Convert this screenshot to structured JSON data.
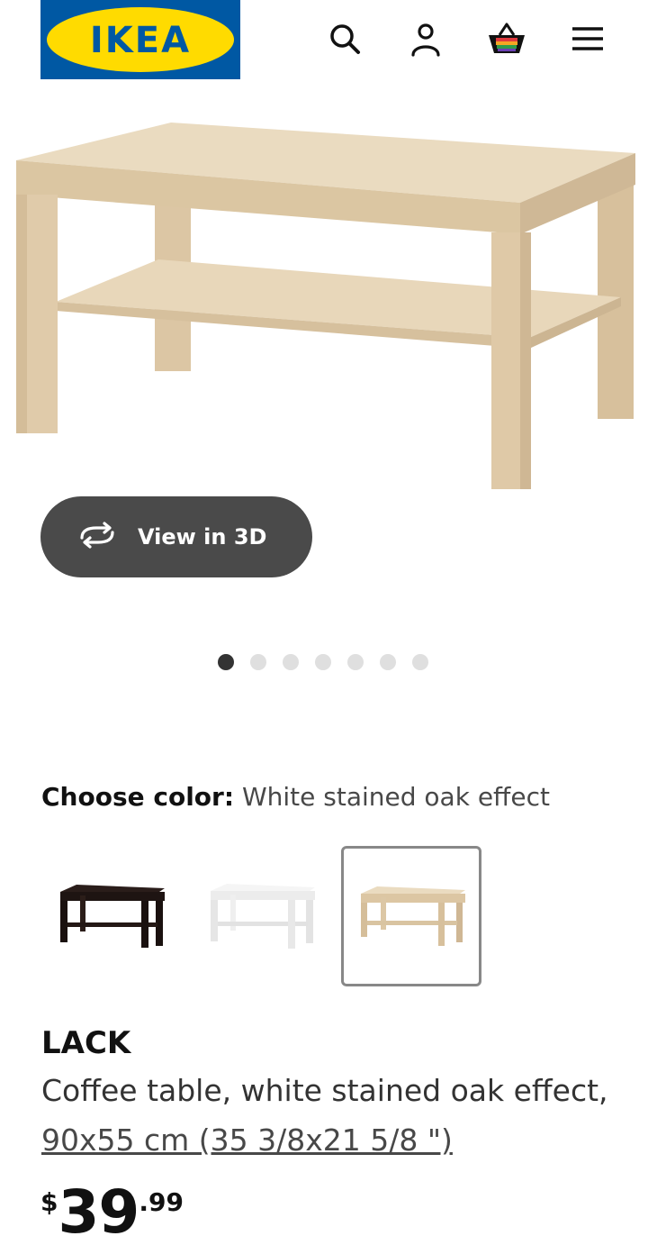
{
  "header": {
    "logo_text": "IKEA",
    "icons": [
      "search-icon",
      "account-icon",
      "cart-icon",
      "menu-icon"
    ]
  },
  "hero": {
    "view3d_label": "View in 3D",
    "carousel_total": 7,
    "carousel_active": 1
  },
  "color_picker": {
    "label": "Choose color:",
    "selected_value": "White stained oak effect",
    "swatches": [
      "black-brown",
      "white",
      "white stained oak effect"
    ],
    "selected_index": 2
  },
  "product": {
    "name": "LACK",
    "description": "Coffee table, white stained oak effect,",
    "size": "90x55 cm (35 3/8x21 5/8 \")",
    "price": {
      "currency": "$",
      "integer": "39",
      "decimal": ".99"
    }
  },
  "colors": {
    "brand_blue": "#0058a3",
    "brand_yellow": "#ffdb00",
    "button_dark": "#4a4a4a",
    "oak": "#e4d3b6"
  }
}
